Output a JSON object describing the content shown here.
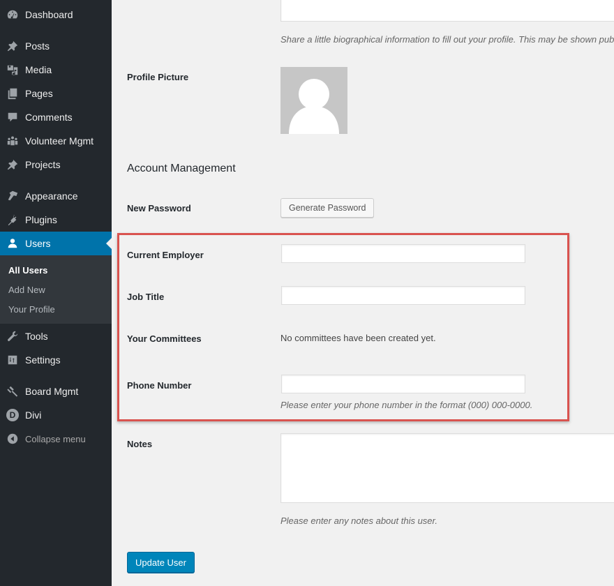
{
  "sidebar": {
    "items": [
      {
        "label": "Dashboard",
        "icon": "dashboard-icon"
      },
      {
        "label": "Posts",
        "icon": "pushpin-icon"
      },
      {
        "label": "Media",
        "icon": "media-icon"
      },
      {
        "label": "Pages",
        "icon": "pages-icon"
      },
      {
        "label": "Comments",
        "icon": "comment-icon"
      },
      {
        "label": "Volunteer Mgmt",
        "icon": "groups-icon"
      },
      {
        "label": "Projects",
        "icon": "pushpin-icon"
      },
      {
        "label": "Appearance",
        "icon": "paintbrush-icon"
      },
      {
        "label": "Plugins",
        "icon": "plug-icon"
      },
      {
        "label": "Users",
        "icon": "user-icon",
        "active": true
      },
      {
        "label": "Tools",
        "icon": "wrench-icon"
      },
      {
        "label": "Settings",
        "icon": "settings-sliders-icon"
      },
      {
        "label": "Board Mgmt",
        "icon": "gavel-icon"
      },
      {
        "label": "Divi",
        "icon": "divi-logo-icon"
      }
    ],
    "users_submenu": [
      {
        "label": "All Users",
        "current": true
      },
      {
        "label": "Add New"
      },
      {
        "label": "Your Profile"
      }
    ],
    "collapse_label": "Collapse menu",
    "divi_letter": "D"
  },
  "form": {
    "bio_description": "Share a little biographical information to fill out your profile. This may be shown publicly.",
    "profile_picture_label": "Profile Picture",
    "account_management_heading": "Account Management",
    "new_password_label": "New Password",
    "generate_password_button": "Generate Password",
    "current_employer_label": "Current Employer",
    "current_employer_value": "",
    "job_title_label": "Job Title",
    "job_title_value": "",
    "committees_label": "Your Committees",
    "committees_text": "No committees have been created yet.",
    "phone_label": "Phone Number",
    "phone_value": "",
    "phone_description": "Please enter your phone number in the format (000) 000-0000.",
    "notes_label": "Notes",
    "notes_value": "",
    "notes_description": "Please enter any notes about this user.",
    "update_button": "Update User"
  },
  "colors": {
    "sidebar_bg": "#23282d",
    "active_menu": "#0073aa",
    "primary_button": "#0085ba",
    "highlight_border": "#d9534f"
  }
}
